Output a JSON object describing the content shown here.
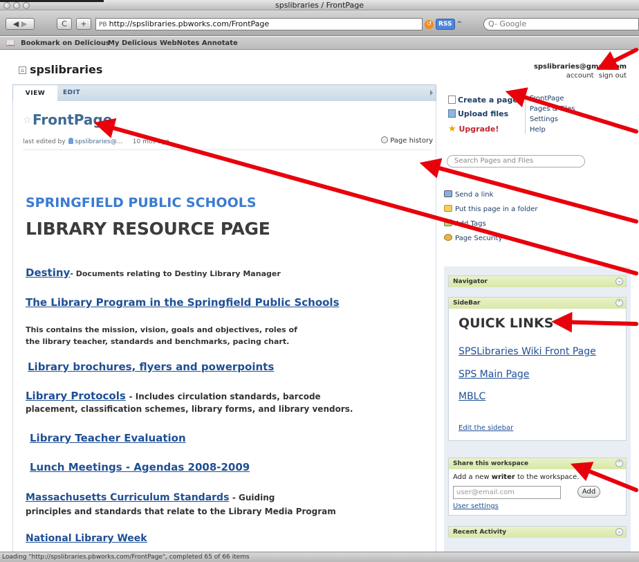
{
  "browser": {
    "window_title": "spslibraries / FrontPage",
    "url": "http://spslibraries.pbworks.com/FrontPage",
    "url_badge": "PB",
    "rss_label": "RSS",
    "search_placeholder": "Q- Google",
    "bookmarks": [
      "Bookmark on Delicious",
      "My Delicious",
      "WebNotes Annotate"
    ],
    "status": "Loading \"http://spslibraries.pbworks.com/FrontPage\", completed 65 of 66 items"
  },
  "site": {
    "name": "spslibraries",
    "user_email": "spslibraries@gmail.com",
    "account_link": "account",
    "signout_link": "sign out"
  },
  "tabs": {
    "view": "VIEW",
    "edit": "EDIT"
  },
  "page": {
    "title": "FrontPage",
    "last_edited_prefix": "last edited by",
    "last_edited_by": "spslibraries@...",
    "last_edited_when": "10 mos ago",
    "page_history": "Page history"
  },
  "content": {
    "heading_school": "SPRINGFIELD PUBLIC SCHOOLS",
    "heading_resource": "LIBRARY RESOURCE PAGE",
    "items": [
      {
        "link": "Destiny",
        "desc": "- Documents relating to Destiny Library Manager"
      },
      {
        "link": "The Library Program in the Springfield Public Schools"
      },
      {
        "desc_line1": "This contains the mission, vision, goals and objectives, roles of",
        "desc_line2": "the library teacher, standards and benchmarks, pacing chart."
      },
      {
        "link": "Library brochures, flyers and powerpoints"
      },
      {
        "link": "Library Protocols",
        "desc": "- Includes circulation standards, barcode",
        "desc_line2": "placement, classification schemes, library forms, and library vendors."
      },
      {
        "link": "Library Teacher Evaluation"
      },
      {
        "link": "Lunch Meetings - Agendas 2008-2009"
      },
      {
        "link": "Massachusetts Curriculum Standards",
        "desc": "- Guiding",
        "desc_line2": "principles and standards that relate to the Library Media Program"
      },
      {
        "link": "National Library Week"
      }
    ]
  },
  "actions": {
    "create_page": "Create a page",
    "upload_files": "Upload files",
    "upgrade": "Upgrade!",
    "nav_links": [
      "FrontPage",
      "Pages & Files",
      "Settings",
      "Help"
    ],
    "search_placeholder": "Search Pages and Files"
  },
  "tools": {
    "send_link": "Send a link",
    "put_folder": "Put this page in a folder",
    "add_tags": "Add Tags",
    "page_security": "Page Security"
  },
  "sidebar": {
    "navigator": "Navigator",
    "sidebar_label": "SideBar",
    "quick_links_title": "QUICK LINKS",
    "quick_links": [
      "SPSLibraries Wiki Front Page",
      "SPS Main Page",
      "MBLC"
    ],
    "edit_sidebar": "Edit the sidebar",
    "share_title": "Share this workspace",
    "share_text_pre": "Add a new ",
    "share_text_bold": "writer",
    "share_text_post": " to the workspace.",
    "share_placeholder": "user@email.com",
    "share_button": "Add",
    "user_settings": "User settings",
    "recent_activity": "Recent Activity"
  },
  "annotation_color": "#e8000b"
}
